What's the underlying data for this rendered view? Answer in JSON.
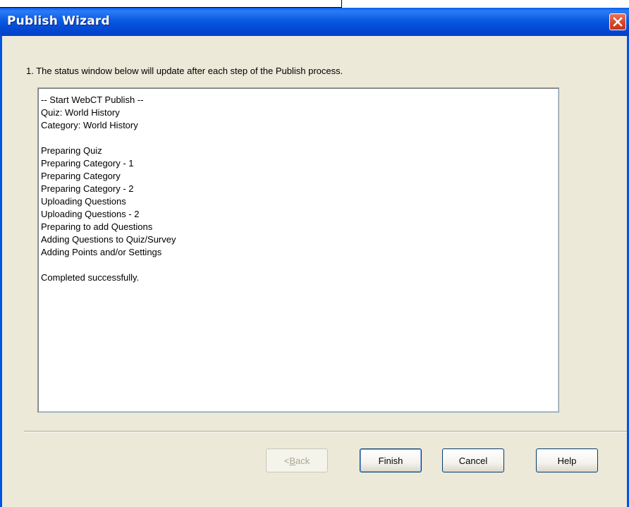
{
  "window": {
    "title": "Publish Wizard"
  },
  "instruction": "1.  The status window below will update after each step of the Publish process.",
  "status_lines": [
    "-- Start WebCT Publish --",
    "Quiz: World History",
    "Category: World History",
    "",
    "Preparing Quiz",
    "Preparing Category - 1",
    "Preparing Category",
    "Preparing Category - 2",
    "Uploading Questions",
    "Uploading Questions - 2",
    "Preparing to add Questions",
    "Adding Questions to Quiz/Survey",
    "Adding Points and/or Settings",
    "",
    "Completed successfully."
  ],
  "buttons": {
    "back_prefix": "< ",
    "back_mnemonic": "B",
    "back_suffix": "ack",
    "finish": "Finish",
    "cancel": "Cancel",
    "help": "Help"
  },
  "icons": {
    "close": "close-icon"
  },
  "colors": {
    "titlebar": "#0a5ee8",
    "window_bg": "#ece9d8",
    "close_button": "#d9462a"
  }
}
